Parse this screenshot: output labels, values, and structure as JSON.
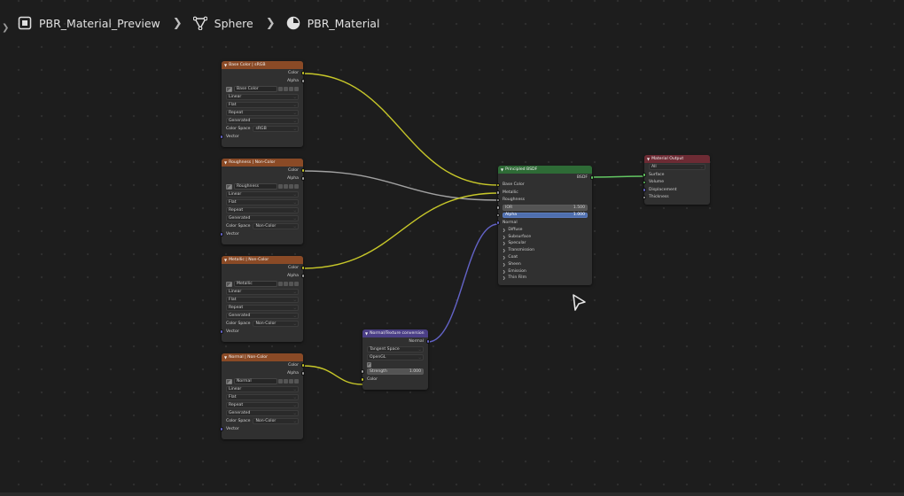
{
  "breadcrumb": {
    "object": "PBR_Material_Preview",
    "mesh": "Sphere",
    "material": "PBR_Material"
  },
  "icons": {
    "object": "object-icon",
    "mesh": "mesh-icon",
    "material": "material-icon",
    "separator": "chevron-right-icon",
    "cursor": "mouse-cursor-icon"
  },
  "colors": {
    "canvas": "#1d1d1d",
    "node_body": "#303030",
    "header_texture": "#8a4a26",
    "header_shader": "#2e6b36",
    "header_vector": "#4b3f86",
    "header_output": "#6d2b34",
    "socket_color": "#c7c729",
    "socket_float": "#a1a1a1",
    "socket_vector": "#6363c7",
    "socket_shader": "#63c763"
  },
  "nodes": {
    "base_color": {
      "title": "Base Color | sRGB",
      "out_color": "Color",
      "out_alpha": "Alpha",
      "image": "Base Color",
      "interpolation": "Linear",
      "projection": "Flat",
      "extension": "Repeat",
      "source": "Generated",
      "color_space_label": "Color Space",
      "color_space": "sRGB",
      "in_vector": "Vector"
    },
    "roughness": {
      "title": "Roughness | Non-Color",
      "out_color": "Color",
      "out_alpha": "Alpha",
      "image": "Roughness",
      "interpolation": "Linear",
      "projection": "Flat",
      "extension": "Repeat",
      "source": "Generated",
      "color_space_label": "Color Space",
      "color_space": "Non-Color",
      "in_vector": "Vector"
    },
    "metallic": {
      "title": "Metallic | Non-Color",
      "out_color": "Color",
      "out_alpha": "Alpha",
      "image": "Metallic",
      "interpolation": "Linear",
      "projection": "Flat",
      "extension": "Repeat",
      "source": "Generated",
      "color_space_label": "Color Space",
      "color_space": "Non-Color",
      "in_vector": "Vector"
    },
    "normal": {
      "title": "Normal | Non-Color",
      "out_color": "Color",
      "out_alpha": "Alpha",
      "image": "Normal",
      "interpolation": "Linear",
      "projection": "Flat",
      "extension": "Repeat",
      "source": "Generated",
      "color_space_label": "Color Space",
      "color_space": "Non-Color",
      "in_vector": "Vector"
    },
    "bsdf": {
      "title": "Principled BSDF",
      "out": "BSDF",
      "base_color": "Base Color",
      "metallic": "Metallic",
      "roughness": "Roughness",
      "ior_label": "IOR",
      "ior_value": "1.500",
      "alpha_label": "Alpha",
      "alpha_value": "1.000",
      "normal": "Normal",
      "panels": [
        "Diffuse",
        "Subsurface",
        "Specular",
        "Transmission",
        "Coat",
        "Sheen",
        "Emission",
        "Thin Film"
      ]
    },
    "normal_map": {
      "title": "Normal/Texture conversion",
      "out": "Normal",
      "space": "Tangent Space",
      "convention": "OpenGL",
      "strength_label": "Strength",
      "strength_value": "1.000",
      "in_color": "Color"
    },
    "output": {
      "title": "Material Output",
      "target": "All",
      "surface": "Surface",
      "volume": "Volume",
      "displacement": "Displacement",
      "thickness": "Thickness"
    }
  }
}
